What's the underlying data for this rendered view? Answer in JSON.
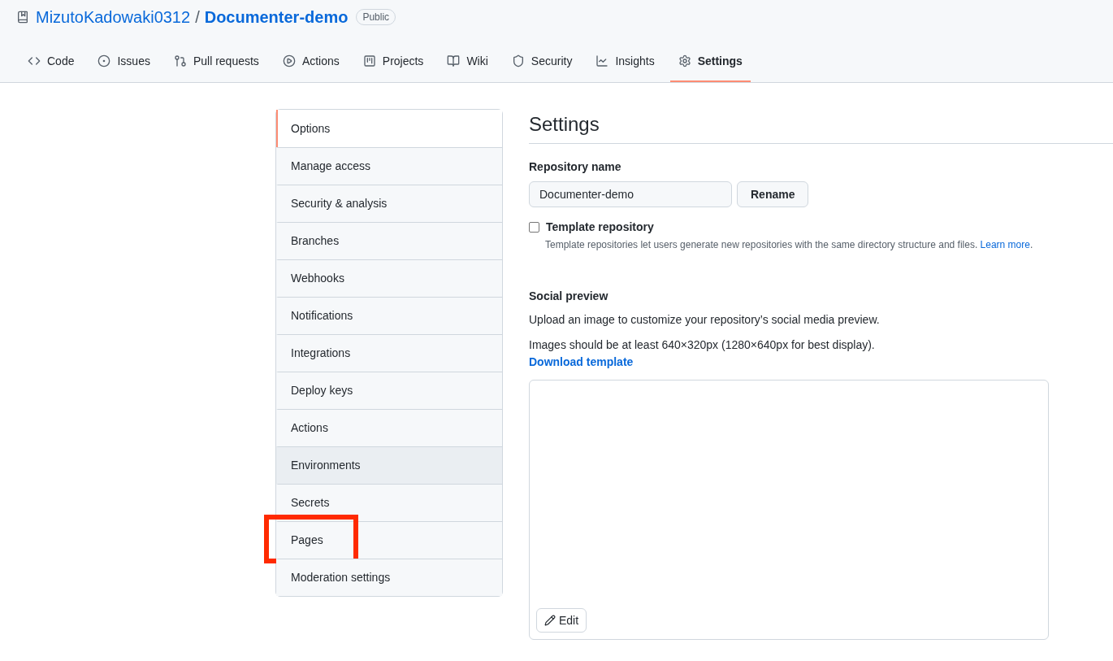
{
  "repo": {
    "owner": "MizutoKadowaki0312",
    "separator": "/",
    "name": "Documenter-demo",
    "visibility": "Public"
  },
  "tabs": [
    {
      "label": "Code",
      "selected": false
    },
    {
      "label": "Issues",
      "selected": false
    },
    {
      "label": "Pull requests",
      "selected": false
    },
    {
      "label": "Actions",
      "selected": false
    },
    {
      "label": "Projects",
      "selected": false
    },
    {
      "label": "Wiki",
      "selected": false
    },
    {
      "label": "Security",
      "selected": false
    },
    {
      "label": "Insights",
      "selected": false
    },
    {
      "label": "Settings",
      "selected": true
    }
  ],
  "sidebar": {
    "items": [
      {
        "label": "Options",
        "selected": true,
        "hovered": false,
        "highlighted": false
      },
      {
        "label": "Manage access",
        "selected": false,
        "hovered": false,
        "highlighted": false
      },
      {
        "label": "Security & analysis",
        "selected": false,
        "hovered": false,
        "highlighted": false
      },
      {
        "label": "Branches",
        "selected": false,
        "hovered": false,
        "highlighted": false
      },
      {
        "label": "Webhooks",
        "selected": false,
        "hovered": false,
        "highlighted": false
      },
      {
        "label": "Notifications",
        "selected": false,
        "hovered": false,
        "highlighted": false
      },
      {
        "label": "Integrations",
        "selected": false,
        "hovered": false,
        "highlighted": false
      },
      {
        "label": "Deploy keys",
        "selected": false,
        "hovered": false,
        "highlighted": false
      },
      {
        "label": "Actions",
        "selected": false,
        "hovered": false,
        "highlighted": false
      },
      {
        "label": "Environments",
        "selected": false,
        "hovered": true,
        "highlighted": false
      },
      {
        "label": "Secrets",
        "selected": false,
        "hovered": false,
        "highlighted": false
      },
      {
        "label": "Pages",
        "selected": false,
        "hovered": false,
        "highlighted": true
      },
      {
        "label": "Moderation settings",
        "selected": false,
        "hovered": false,
        "highlighted": false
      }
    ]
  },
  "main": {
    "title": "Settings",
    "repository_name": {
      "label": "Repository name",
      "value": "Documenter-demo",
      "button": "Rename"
    },
    "template": {
      "label": "Template repository",
      "checked": false,
      "description": "Template repositories let users generate new repositories with the same directory structure and files.",
      "link": "Learn more",
      "after_link": "."
    },
    "social_preview": {
      "label": "Social preview",
      "text_1": "Upload an image to customize your repository’s social media preview.",
      "text_2": "Images should be at least 640×320px (1280×640px for best display).",
      "link": "Download template",
      "edit_button": "Edit"
    }
  }
}
